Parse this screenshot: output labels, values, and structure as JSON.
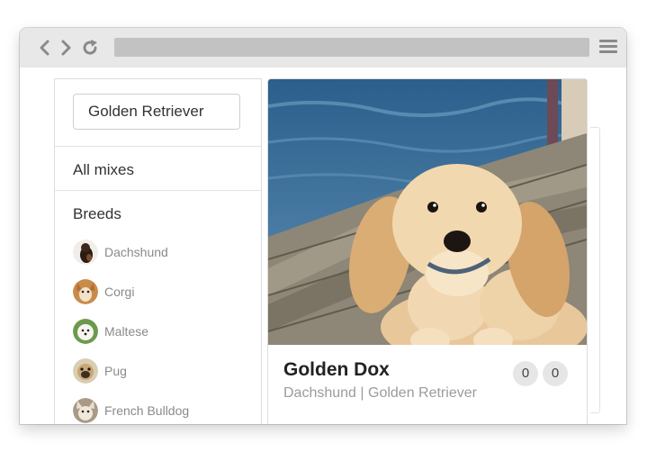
{
  "browser": {
    "back_icon": "chevron-left-icon",
    "forward_icon": "chevron-right-icon",
    "reload_icon": "reload-icon",
    "menu_icon": "hamburger-menu-icon"
  },
  "sidebar": {
    "search": {
      "value": "Golden Retriever"
    },
    "all_mixes_label": "All mixes",
    "breeds_heading": "Breeds",
    "breeds": [
      {
        "label": "Dachshund"
      },
      {
        "label": "Corgi"
      },
      {
        "label": "Maltese"
      },
      {
        "label": "Pug"
      },
      {
        "label": "French Bulldog"
      }
    ]
  },
  "card": {
    "title": "Golden Dox",
    "subtitle": "Dachshund | Golden Retriever",
    "likes": "0",
    "dislikes": "0"
  },
  "colors": {
    "chrome_bar": "#e8e8e8",
    "address_bar": "#c2c2c2",
    "muted_text": "#9b9b9b",
    "counter_bg": "#e6e6e6"
  }
}
